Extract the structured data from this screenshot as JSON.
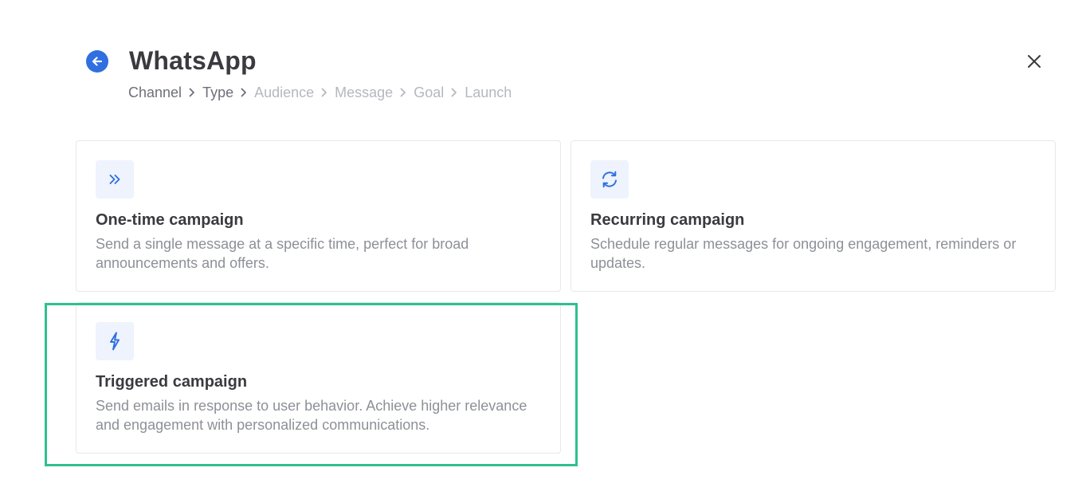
{
  "header": {
    "title": "WhatsApp",
    "back_icon": "arrow-left-circle-icon",
    "close_icon": "close-icon"
  },
  "breadcrumb": [
    {
      "label": "Channel",
      "state": "done"
    },
    {
      "label": "Type",
      "state": "current"
    },
    {
      "label": "Audience",
      "state": "upcoming"
    },
    {
      "label": "Message",
      "state": "upcoming"
    },
    {
      "label": "Goal",
      "state": "upcoming"
    },
    {
      "label": "Launch",
      "state": "upcoming"
    }
  ],
  "cards": [
    {
      "icon": "double-chevron-right-icon",
      "title": "One-time campaign",
      "description": "Send a single message at a specific time, perfect for broad announcements and offers."
    },
    {
      "icon": "refresh-icon",
      "title": "Recurring campaign",
      "description": "Schedule regular messages for ongoing engagement, reminders or updates."
    },
    {
      "icon": "lightning-icon",
      "title": "Triggered campaign",
      "description": "Send emails in response to user behavior. Achieve higher relevance and engagement with personalized communications.",
      "highlighted": true
    }
  ],
  "colors": {
    "accent": "#2f6fe0",
    "icon_bg": "#eef3fd",
    "highlight": "#2ec08f",
    "title_text": "#3a3a3f",
    "muted_text": "#8d9097"
  }
}
